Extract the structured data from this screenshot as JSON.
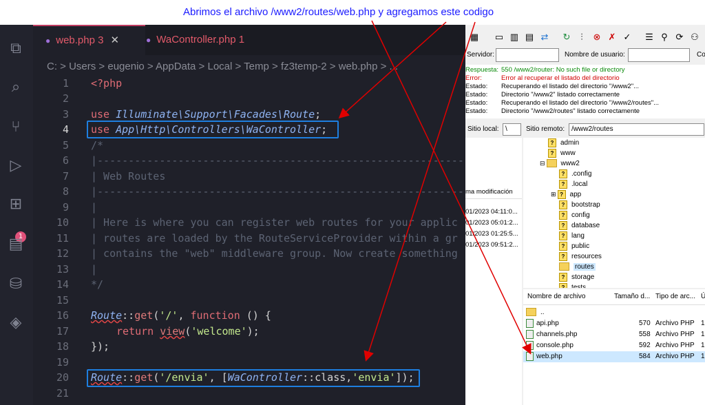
{
  "annotation": {
    "text": "Abrimos el archivo /www2/routes/web.php y agregamos este codigo"
  },
  "editor": {
    "tabs": [
      {
        "label": "web.php",
        "count": "3",
        "close": "✕"
      },
      {
        "label": "WaController.php",
        "count": "1"
      }
    ],
    "breadcrumb": "C: > Users > eugenio > AppData > Local > Temp > fz3temp-2 > web.php > ...",
    "badge_count": "1",
    "line_numbers": [
      "1",
      "2",
      "3",
      "4",
      "5",
      "6",
      "7",
      "8",
      "9",
      "10",
      "11",
      "12",
      "13",
      "14",
      "15",
      "16",
      "17",
      "18",
      "19",
      "20",
      "21"
    ],
    "code": {
      "php_open": "<?php",
      "use1_kw": "use",
      "use1_ns": "Illuminate\\Support\\Facades\\Route",
      "use2_kw": "use",
      "use2_ns": "App\\Http\\Controllers\\WaController",
      "semicolon": ";",
      "c_open": "/*",
      "c_dashes": "|--------------------------------------------------------------------------",
      "c_title": "| Web Routes",
      "c_pipe": "|",
      "c_l10": "| Here is where you can register web routes for your applic",
      "c_l11": "| routes are loaded by the RouteServiceProvider within a gr",
      "c_l12": "| contains the \"web\" middleware group. Now create something",
      "c_close": "*/",
      "l16_route": "Route",
      "l16_op": "::",
      "l16_get": "get",
      "l16_p1": "(",
      "l16_str": "'/'",
      "l16_p2": ", ",
      "l16_func": "function",
      "l16_p3": " () {",
      "l17_ret": "return",
      "l17_view": "view",
      "l17_p1": "(",
      "l17_str": "'welcome'",
      "l17_p2": ");",
      "l18": "});",
      "l20_route": "Route",
      "l20_op": "::",
      "l20_get": "get",
      "l20_p1": "(",
      "l20_str1": "'/envia'",
      "l20_p2": ", [",
      "l20_cls": "WaController",
      "l20_p3": "::class,",
      "l20_str2": "'envia'",
      "l20_p4": "]);"
    }
  },
  "filezilla": {
    "connect": {
      "server_label": "Servidor:",
      "user_label": "Nombre de usuario:",
      "extra_label": "Co"
    },
    "log": [
      {
        "key": "Respuesta:",
        "value": "550 /www2/router: No such file or directory",
        "color": "green"
      },
      {
        "key": "Error:",
        "value": "Error al recuperar el listado del directorio",
        "color": "red"
      },
      {
        "key": "Estado:",
        "value": "Recuperando el listado del directorio \"/www2\"...",
        "color": "black"
      },
      {
        "key": "Estado:",
        "value": "Directorio \"/www2\" listado correctamente",
        "color": "black"
      },
      {
        "key": "Estado:",
        "value": "Recuperando el listado del directorio \"/www2/routes\"...",
        "color": "black"
      },
      {
        "key": "Estado:",
        "value": "Directorio \"/www2/routes\" listado correctamente",
        "color": "black"
      }
    ],
    "local_site_label": "Sitio local:",
    "local_site_value": "\\",
    "remote_site_label": "Sitio remoto:",
    "remote_site_value": "/www2/routes",
    "local_list_header": "ma modificación",
    "local_dates": [
      "01/2023 04:11:0...",
      "01/2023 05:01:2...",
      "01/2023 01:25:5...",
      "01/2023 09:51:2..."
    ],
    "remote_tree": [
      {
        "label": "admin",
        "icon": "q"
      },
      {
        "label": "www",
        "icon": "q"
      },
      {
        "label": "www2",
        "icon": "folder"
      },
      {
        "label": ".config",
        "icon": "q"
      },
      {
        "label": ".local",
        "icon": "q"
      },
      {
        "label": "app",
        "icon": "q"
      },
      {
        "label": "bootstrap",
        "icon": "q"
      },
      {
        "label": "config",
        "icon": "q"
      },
      {
        "label": "database",
        "icon": "q"
      },
      {
        "label": "lang",
        "icon": "q"
      },
      {
        "label": "public",
        "icon": "q"
      },
      {
        "label": "resources",
        "icon": "q"
      },
      {
        "label": "routes",
        "icon": "folder"
      },
      {
        "label": "storage",
        "icon": "q"
      },
      {
        "label": "tests",
        "icon": "q"
      }
    ],
    "remote_list_headers": [
      "Nombre de archivo",
      "Tamaño d...",
      "Tipo de arc...",
      "Ú"
    ],
    "remote_files": [
      {
        "name": "..",
        "size": "",
        "type": "",
        "extra": ""
      },
      {
        "name": "api.php",
        "size": "570",
        "type": "Archivo PHP",
        "extra": "1"
      },
      {
        "name": "channels.php",
        "size": "558",
        "type": "Archivo PHP",
        "extra": "1"
      },
      {
        "name": "console.php",
        "size": "592",
        "type": "Archivo PHP",
        "extra": "1"
      },
      {
        "name": "web.php",
        "size": "584",
        "type": "Archivo PHP",
        "extra": "1"
      }
    ]
  }
}
